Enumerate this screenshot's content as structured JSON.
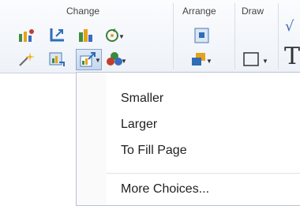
{
  "ribbon": {
    "groups": {
      "change": "Change",
      "arrange": "Arrange",
      "draw": "Draw"
    },
    "partial_glyph_top": "√",
    "partial_glyph_bottom": "T"
  },
  "menu": {
    "items": {
      "smaller": "Smaller",
      "larger": "Larger",
      "to_fill_page": "To Fill Page",
      "more_choices": "More Choices..."
    }
  },
  "colors": {
    "ribbon_bg": "#eef2f8",
    "menu_border": "#b9c3d0",
    "pressed_button": "#c6d7ee"
  },
  "icons": [
    "change-picture-icon",
    "crop-icon",
    "recolor-icon",
    "rotate-icon",
    "effects-icon",
    "reset-picture-icon",
    "resize-picture-icon",
    "color-scheme-icon",
    "position-icon",
    "group-order-icon",
    "rectangle-shape-icon"
  ]
}
